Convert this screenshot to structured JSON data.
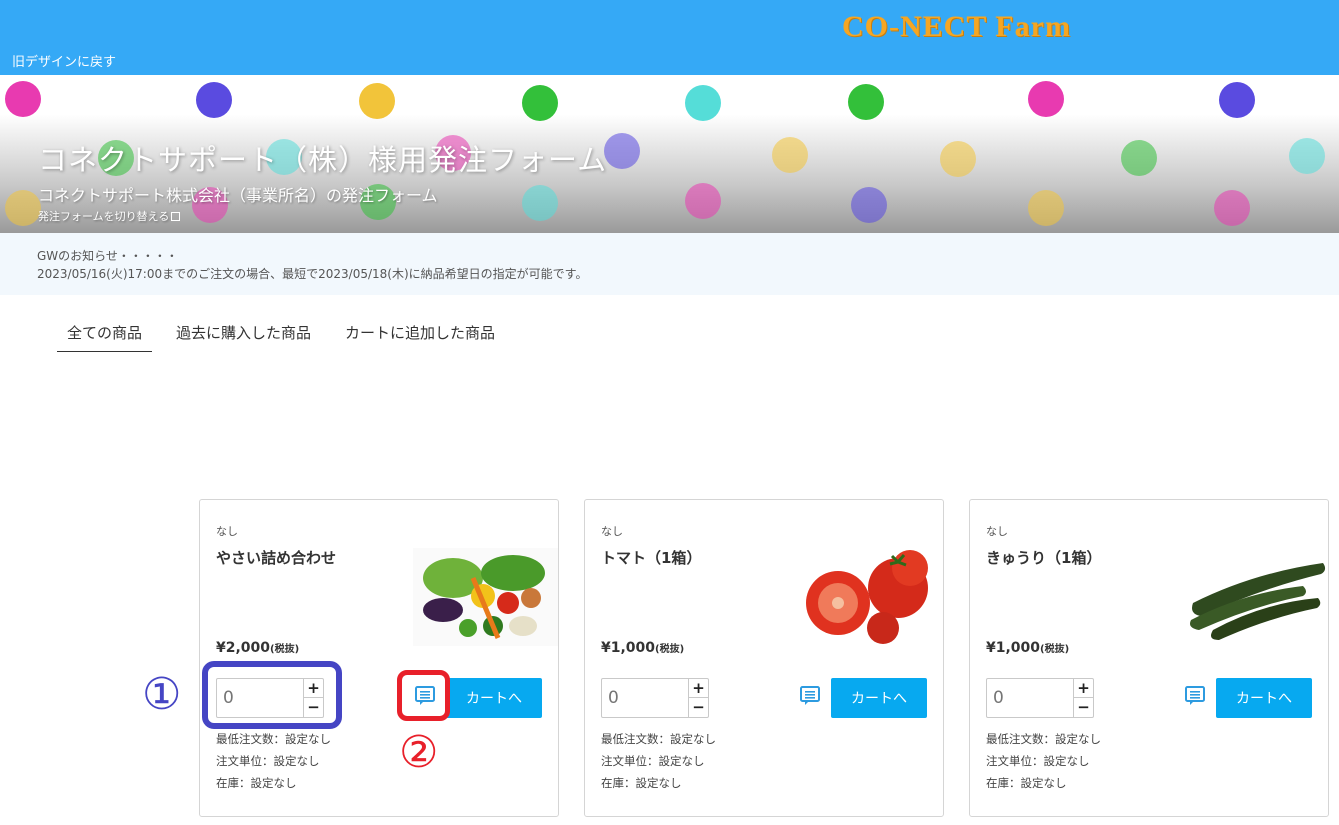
{
  "header": {
    "brand": "CO-NECT Farm",
    "back_link": "旧デザインに戻す"
  },
  "hero": {
    "title": "コネクトサポート（株）様用発注フォーム",
    "subtitle": "コネクトサポート株式会社（事業所名）の発注フォーム",
    "switch_link": "発注フォームを切り替える"
  },
  "notice": {
    "line1": "GWのお知らせ・・・・・",
    "line2": "2023/05/16(火)17:00までのご注文の場合、最短で2023/05/18(木)に納品希望日の指定が可能です。"
  },
  "tabs": [
    "全ての商品",
    "過去に購入した商品",
    "カートに追加した商品"
  ],
  "products": [
    {
      "tag": "なし",
      "name": "やさい詰め合わせ",
      "price": "¥2,000",
      "tax": "(税抜)",
      "quantity_placeholder": "0",
      "cart_label": "カートへ",
      "min_order": "最低注文数：設定なし",
      "order_unit": "注文単位：設定なし",
      "stock": "在庫：設定なし",
      "image": "vegetable-assortment-image"
    },
    {
      "tag": "なし",
      "name": "トマト（1箱）",
      "price": "¥1,000",
      "tax": "(税抜)",
      "quantity_placeholder": "0",
      "cart_label": "カートへ",
      "min_order": "最低注文数：設定なし",
      "order_unit": "注文単位：設定なし",
      "stock": "在庫：設定なし",
      "image": "tomato-image"
    },
    {
      "tag": "なし",
      "name": "きゅうり（1箱）",
      "price": "¥1,000",
      "tax": "(税抜)",
      "quantity_placeholder": "0",
      "cart_label": "カートへ",
      "min_order": "最低注文数：設定なし",
      "order_unit": "注文単位：設定なし",
      "stock": "在庫：設定なし",
      "image": "cucumber-image"
    }
  ],
  "stepper": {
    "plus": "+",
    "minus": "−"
  },
  "annotations": {
    "one": "①",
    "two": "②"
  },
  "colors": {
    "topbar": "#35a9f6",
    "brand": "#f5a623",
    "cart_button": "#07a9f0",
    "annotation_blue": "#4545c4",
    "annotation_red": "#e8202a"
  }
}
